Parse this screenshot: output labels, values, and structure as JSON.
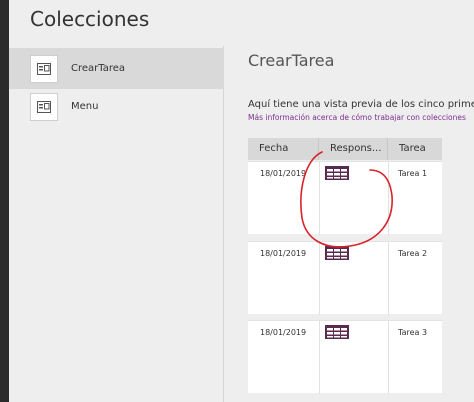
{
  "header": {
    "title": "Colecciones"
  },
  "sidebar": {
    "items": [
      {
        "label": "CrearTarea",
        "icon": "screen-form-icon",
        "selected": true
      },
      {
        "label": "Menu",
        "icon": "screen-form-icon",
        "selected": false
      }
    ]
  },
  "main": {
    "title": "CrearTarea",
    "preview_text": "Aquí tiene una vista previa de los cinco primeros",
    "learn_link": "Más información acerca de cómo trabajar con colecciones",
    "table": {
      "columns": [
        "Fecha",
        "Respons...",
        "Tarea"
      ],
      "rows": [
        {
          "fecha": "18/01/2019",
          "responsable_icon": "image-table-icon",
          "tarea": "Tarea 1"
        },
        {
          "fecha": "18/01/2019",
          "responsable_icon": "image-table-icon",
          "tarea": "Tarea 2"
        },
        {
          "fecha": "18/01/2019",
          "responsable_icon": "image-table-icon",
          "tarea": "Tarea 3"
        }
      ]
    }
  },
  "colors": {
    "accent_link": "#7b2e8e",
    "table_icon": "#5a2a4f",
    "annotation": "#d9232a"
  }
}
